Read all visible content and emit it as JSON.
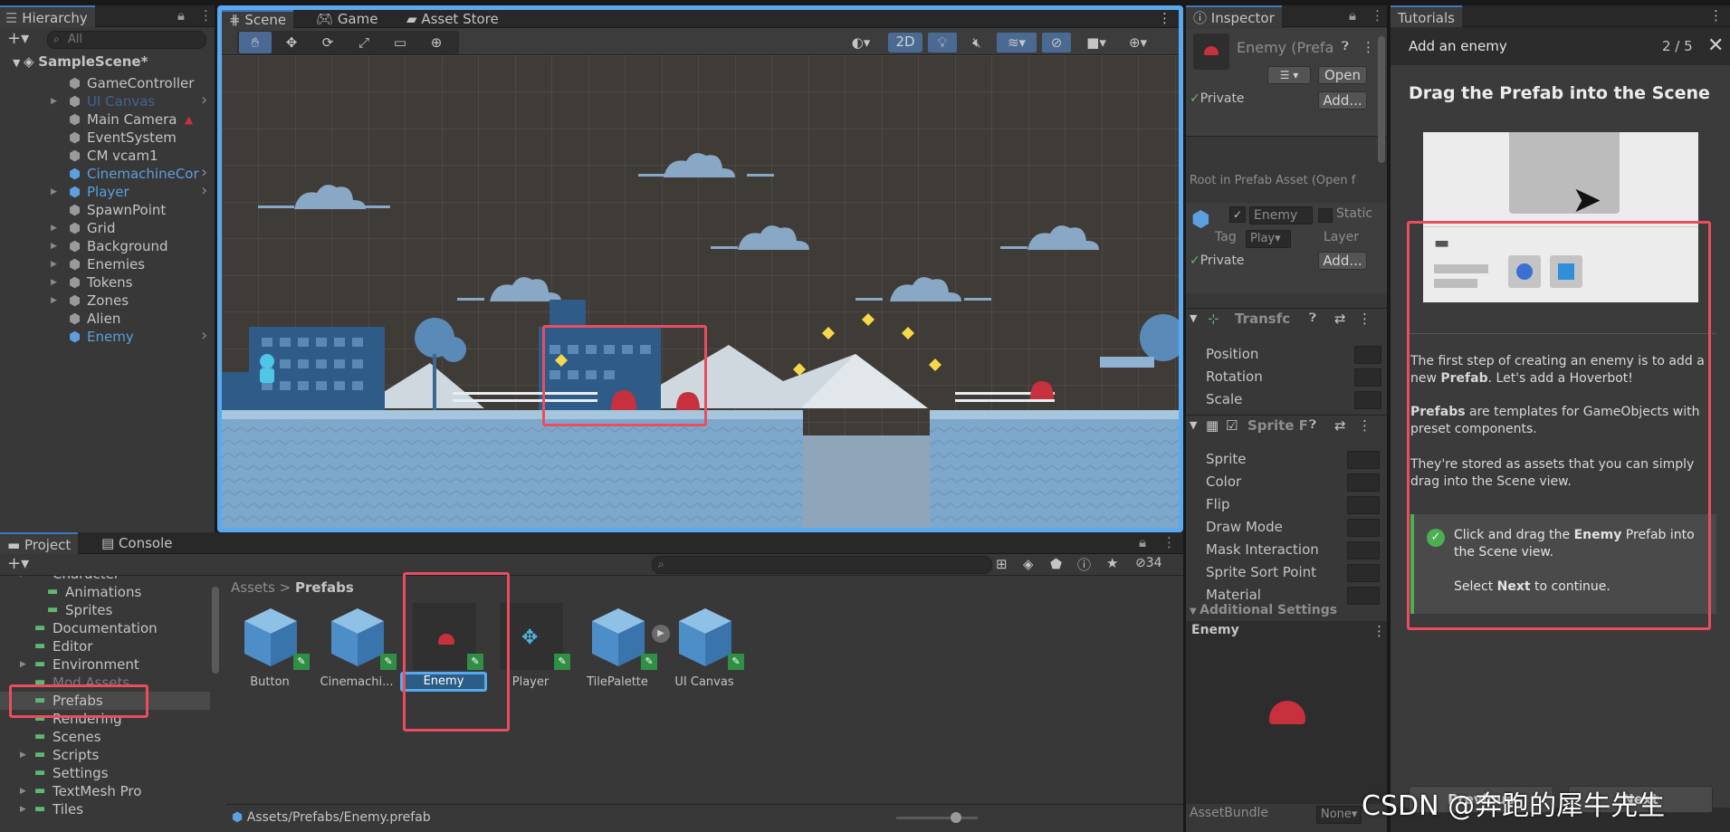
{
  "hierarchy": {
    "tab": "Hierarchy",
    "search_placeholder": "All",
    "scene": "SampleScene*",
    "items": [
      {
        "label": "GameController",
        "state": "normal"
      },
      {
        "label": "UI Canvas",
        "state": "hidden"
      },
      {
        "label": "Main Camera",
        "state": "normal"
      },
      {
        "label": "EventSystem",
        "state": "normal"
      },
      {
        "label": "CM vcam1",
        "state": "normal"
      },
      {
        "label": "CinemachineCor",
        "state": "prefab"
      },
      {
        "label": "Player",
        "state": "prefab"
      },
      {
        "label": "SpawnPoint",
        "state": "normal"
      },
      {
        "label": "Grid",
        "state": "normal"
      },
      {
        "label": "Background",
        "state": "normal"
      },
      {
        "label": "Enemies",
        "state": "normal"
      },
      {
        "label": "Tokens",
        "state": "normal"
      },
      {
        "label": "Zones",
        "state": "normal"
      },
      {
        "label": "Alien",
        "state": "normal"
      },
      {
        "label": "Enemy",
        "state": "prefab"
      }
    ]
  },
  "scene_view": {
    "tabs": [
      "Scene",
      "Game",
      "Asset Store"
    ],
    "btn_2d": "2D"
  },
  "project": {
    "tabs": [
      "Project",
      "Console"
    ],
    "count": "34",
    "folders": [
      "Character",
      "Animations",
      "Sprites",
      "Documentation",
      "Editor",
      "Environment",
      "Mod Assets",
      "Prefabs",
      "Rendering",
      "Scenes",
      "Scripts",
      "Settings",
      "TextMesh Pro",
      "Tiles"
    ],
    "breadcrumb_root": "Assets",
    "breadcrumb_sep": ">",
    "breadcrumb_current": "Prefabs",
    "assets": [
      "Button",
      "Cinemachi...",
      "Enemy",
      "Player",
      "TilePalette",
      "UI Canvas"
    ],
    "path": "Assets/Prefabs/Enemy.prefab"
  },
  "inspector": {
    "tab": "Inspector",
    "title": "Enemy (Prefa",
    "open_btn": "Open",
    "private_label": "Private",
    "add_btn": "Add...",
    "root_label": "Root in Prefab Asset (Open f",
    "go_name": "Enemy",
    "static_label": "Static",
    "tag_label": "Tag",
    "tag_value": "Play",
    "layer_label": "Layer",
    "transform_title": "Transfc",
    "transform_props": [
      "Position",
      "Rotation",
      "Scale"
    ],
    "sprite_title": "Sprite F",
    "sprite_props": [
      "Sprite",
      "Color",
      "Flip",
      "Draw Mode",
      "Mask Interaction",
      "Sprite Sort Point",
      "Material"
    ],
    "additional": "Additional Settings",
    "preview_title": "Enemy",
    "assetbundle_label": "AssetBundle",
    "assetbundle_value": "None"
  },
  "tutorials": {
    "tab": "Tutorials",
    "title": "Add an enemy",
    "progress": "2 / 5",
    "heading": "Drag the Prefab into the Scene",
    "p1_a": "The first step of creating an enemy is to add a new ",
    "p1_b": "Prefab",
    "p1_c": ". Let's add a Hoverbot!",
    "p2_a": "Prefabs",
    "p2_b": " are templates for GameObjects with preset components.",
    "p3": "They're stored as assets that you can simply drag into the Scene view.",
    "instr_a": "Click and drag the ",
    "instr_b": "Enemy",
    "instr_c": " Prefab into the Scene view.",
    "instr2_a": "Select ",
    "instr2_b": "Next",
    "instr2_c": " to continue.",
    "prev_btn": "Previous",
    "next_btn": "Next"
  },
  "watermark": "CSDN @奔跑的犀牛先生",
  "colors": {
    "accent": "#3a79bb",
    "highlight": "#ea4d5e",
    "scene_bg": "#3e3a36"
  }
}
